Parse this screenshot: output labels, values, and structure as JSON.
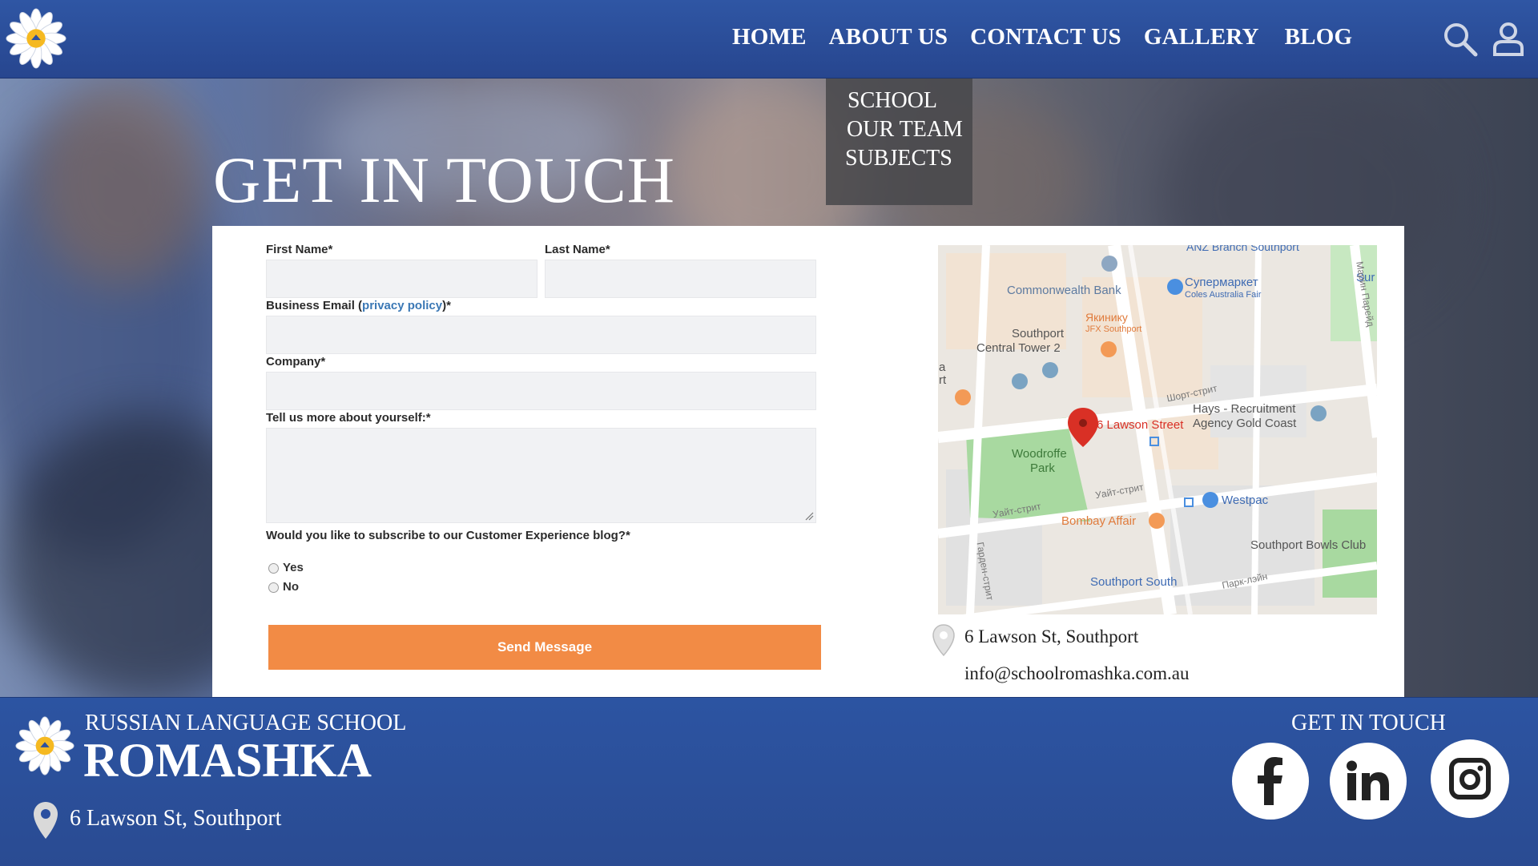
{
  "nav": {
    "items": [
      "HOME",
      "ABOUT US",
      "CONTACT US",
      "GALLERY",
      "BLOG"
    ],
    "dropdown": [
      "SCHOOL",
      "OUR TEAM",
      "SUBJECTS"
    ]
  },
  "hero": {
    "title": "GET IN TOUCH"
  },
  "form": {
    "first_name_label": "First Name*",
    "last_name_label": "Last Name*",
    "email_label_prefix": "Business Email (",
    "email_label_link": "privacy policy",
    "email_label_suffix": ")*",
    "company_label": "Company*",
    "about_label": "Tell us more about yourself:*",
    "subscribe_question": "Would you like to subscribe to our Customer Experience blog?*",
    "option_yes": "Yes",
    "option_no": "No",
    "submit_label": "Send Message"
  },
  "map": {
    "labels": {
      "anz": "ANZ Branch Southport",
      "supermarket": "Супермаркет",
      "supermarket_sub": "Coles Australia Fair",
      "sur": "Sur",
      "commonwealth": "Commonwealth Bank",
      "yakiniku": "Якинику",
      "yakiniku_sub": "JFX Southport",
      "central_tower_1": "Southport",
      "central_tower_2": "Central Tower 2",
      "short_street": "Шорт-стрит",
      "hays_1": "Hays - Recruitment",
      "hays_2": "Agency Gold Coast",
      "lawson": "6 Lawson Street",
      "woodroffe_1": "Woodroffe",
      "woodroffe_2": "Park",
      "white_st_1": "Уайт-стрит",
      "white_st_2": "Уайт-стрит",
      "westpac": "Westpac",
      "bombay": "Bombay Affair",
      "bowls": "Southport Bowls Club",
      "southport_south": "Southport South",
      "park_lane": "Парк-лэйн",
      "marine_parade": "Марин Парейд",
      "garden_st": "Гарден-стрит",
      "edge_a": "a",
      "edge_rt": "rt"
    }
  },
  "contact": {
    "address": "6 Lawson St, Southport",
    "email": "info@schoolromashka.com.au"
  },
  "footer": {
    "school_line": "RUSSIAN LANGUAGE SCHOOL",
    "school_name": "ROMASHKA",
    "address": "6 Lawson St, Southport",
    "get_in_touch": "GET IN TOUCH"
  },
  "colors": {
    "brand_blue": "#2b50a0",
    "accent_orange": "#f28b45",
    "link_blue": "#3b78b5",
    "map_pin_red": "#d93025"
  }
}
